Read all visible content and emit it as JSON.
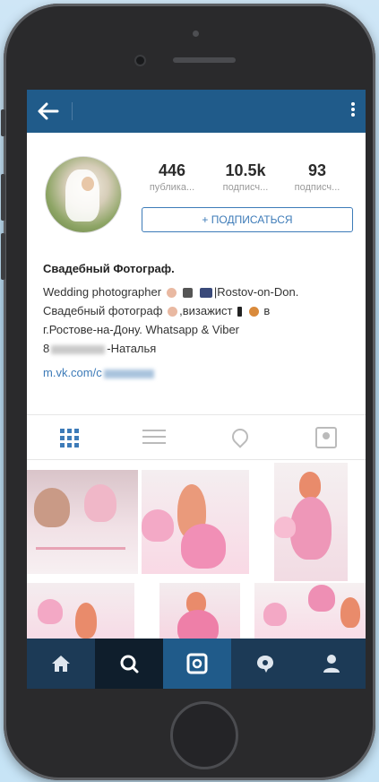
{
  "stats": [
    {
      "number": "446",
      "label": "публика..."
    },
    {
      "number": "10.5k",
      "label": "подписч..."
    },
    {
      "number": "93",
      "label": "подписч..."
    }
  ],
  "subscribe_label": "+ ПОДПИСАТЬСЯ",
  "bio": {
    "name": "Свадебный Фотограф.",
    "line1a": "Wedding photographer",
    "line1b": "|Rostov-on-Don.",
    "line2a": "Свадебный фотограф",
    "line2b": ",визажист",
    "line2c": "в",
    "line3": "г.Ростове-на-Дону. Whatsapp & Viber",
    "line4a": "8",
    "line4b": "-Наталья",
    "link": "m.vk.com/c"
  },
  "icons": {
    "back": "arrow-left-icon",
    "more": "more-vertical-icon",
    "grid": "grid-icon",
    "list": "list-icon",
    "location": "location-pin-icon",
    "tagged": "tagged-user-icon",
    "home": "home-icon",
    "search": "search-icon",
    "camera": "camera-icon",
    "activity": "activity-icon",
    "profile": "profile-icon"
  },
  "colors": {
    "topbar": "#205b8a",
    "accent": "#3d7bb8",
    "bottom_nav": "#1c3a56"
  }
}
